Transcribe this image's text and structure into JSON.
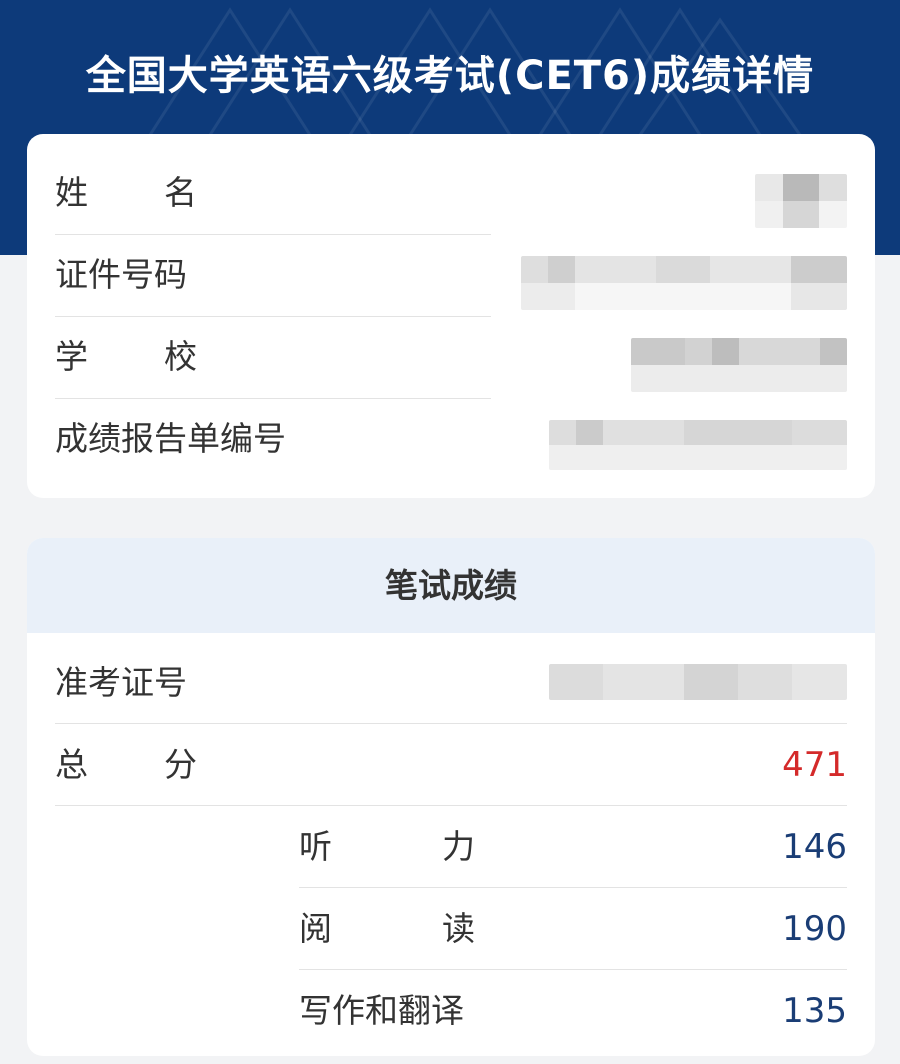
{
  "header": {
    "title": "全国大学英语六级考试(CET6)成绩详情",
    "background_color": "#0d3a7a"
  },
  "personal_info": {
    "name_label": "姓名",
    "id_label": "证件号码",
    "school_label": "学校",
    "report_no_label": "成绩报告单编号"
  },
  "written_score": {
    "section_title": "笔试成绩",
    "admission_label": "准考证号",
    "total_label": "总分",
    "total_value": "471",
    "items": [
      {
        "label": "听力",
        "value": "146"
      },
      {
        "label": "阅读",
        "value": "190"
      },
      {
        "label": "写作和翻译",
        "value": "135"
      }
    ]
  },
  "colors": {
    "total_score": "#d42a2a",
    "sub_score": "#1a3d75",
    "section_header_bg": "#e9f0f9"
  }
}
